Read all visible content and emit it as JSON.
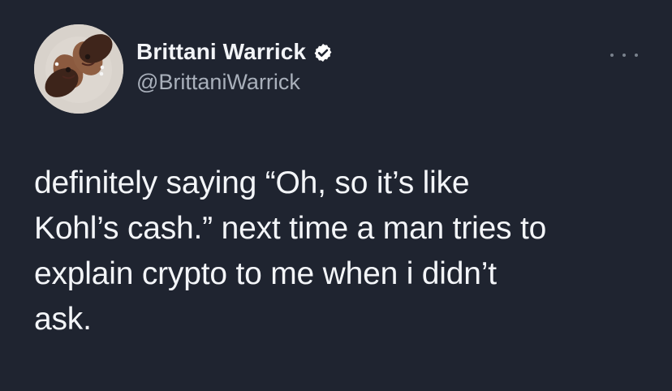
{
  "tweet": {
    "author_name": "Brittani Warrick",
    "author_handle": "@BrittaniWarrick",
    "verified_icon": "verified-badge-icon",
    "more_icon": "more-options-icon",
    "body_lines": [
      "definitely saying “Oh, so it’s like",
      "Kohl’s cash.” next time a man tries to",
      "explain crypto to me when i didn’t",
      "ask."
    ]
  },
  "colors": {
    "background": "#1f2430",
    "text": "#f3f5f8",
    "secondary_text": "#a9b0bb",
    "verified": "#ffffff"
  }
}
